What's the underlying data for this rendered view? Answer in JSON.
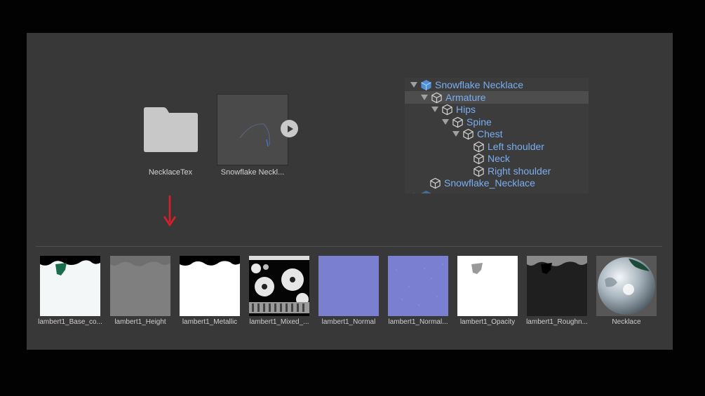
{
  "assets": {
    "folder": {
      "label": "NecklaceTex",
      "icon": "folder-icon"
    },
    "model": {
      "label": "Snowflake Neckl...",
      "play_icon": "play-icon"
    }
  },
  "hierarchy": {
    "rows": [
      {
        "label": "Snowflake Necklace",
        "expanded": true,
        "icon": "prefab-cube-icon"
      },
      {
        "label": "Armature",
        "expanded": true,
        "selected": true,
        "icon": "cube-icon"
      },
      {
        "label": "Hips",
        "expanded": true,
        "icon": "cube-icon"
      },
      {
        "label": "Spine",
        "expanded": true,
        "icon": "cube-icon"
      },
      {
        "label": "Chest",
        "expanded": true,
        "icon": "cube-icon"
      },
      {
        "label": "Left shoulder",
        "icon": "cube-icon"
      },
      {
        "label": "Neck",
        "icon": "cube-icon"
      },
      {
        "label": "Right shoulder",
        "icon": "cube-icon"
      },
      {
        "label": "Snowflake_Necklace",
        "icon": "cube-icon"
      }
    ]
  },
  "textures": [
    {
      "label": "lambert1_Base_co..."
    },
    {
      "label": "lambert1_Height"
    },
    {
      "label": "lambert1_Metallic"
    },
    {
      "label": "lambert1_Mixed_..."
    },
    {
      "label": "lambert1_Normal"
    },
    {
      "label": "lambert1_Normal..."
    },
    {
      "label": "lambert1_Opacity"
    },
    {
      "label": "lambert1_Roughn..."
    },
    {
      "label": "Necklace"
    }
  ],
  "colors": {
    "background": "#020202",
    "panel": "#383838",
    "hierarchy_text": "#7aaef0",
    "arrow": "#e11d2a",
    "normal_map": "#7b7fd0"
  }
}
